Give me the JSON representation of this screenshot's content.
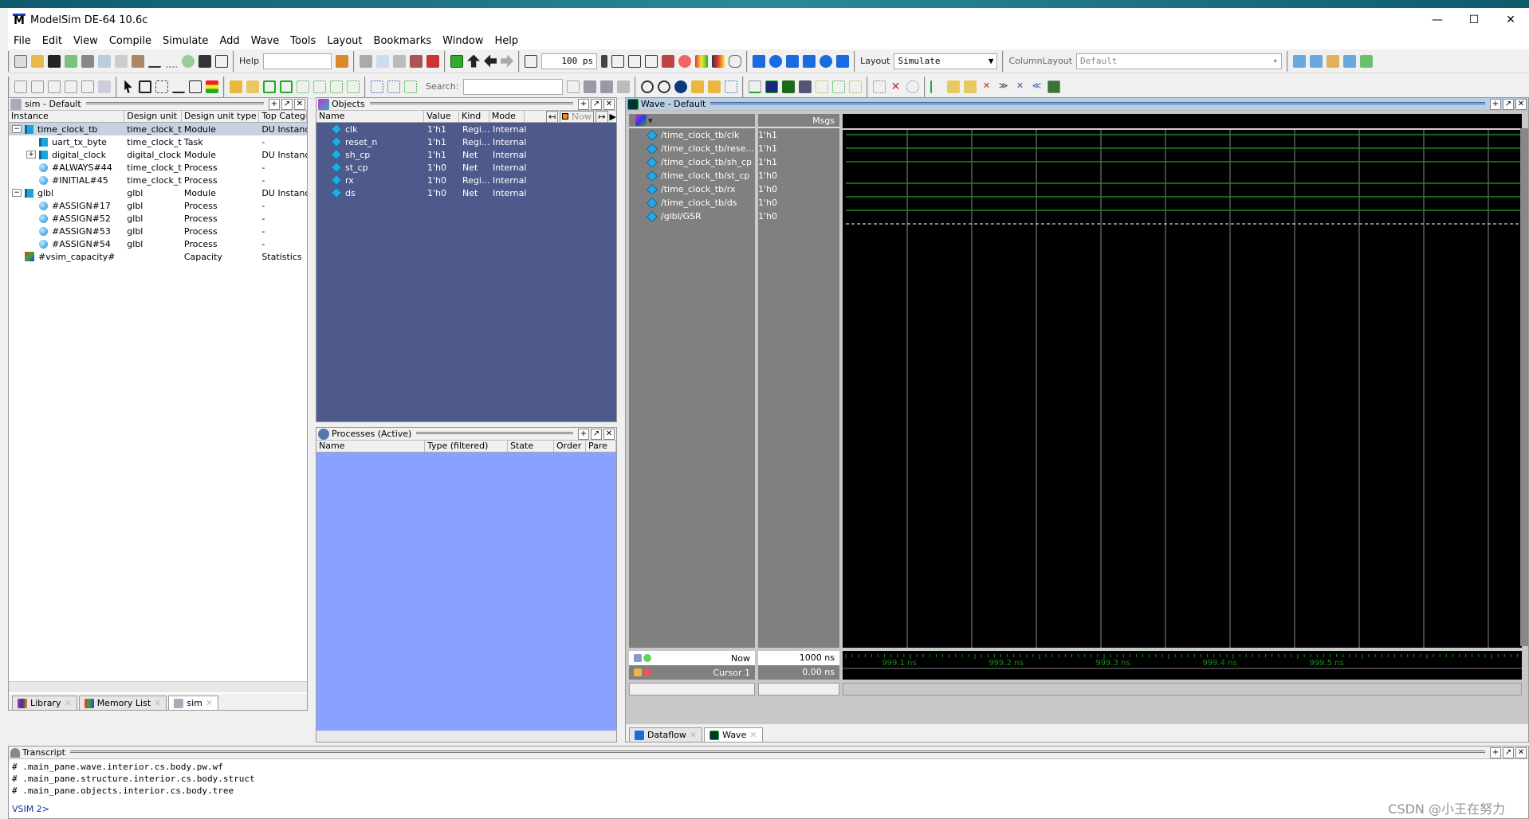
{
  "window": {
    "title": "ModelSim DE-64 10.6c",
    "logo": "M",
    "minimize": "—",
    "maximize": "☐",
    "close": "✕"
  },
  "menu": [
    "File",
    "Edit",
    "View",
    "Compile",
    "Simulate",
    "Add",
    "Wave",
    "Tools",
    "Layout",
    "Bookmarks",
    "Window",
    "Help"
  ],
  "toolbar": {
    "help_label": "Help",
    "help_value": "",
    "time_step": "100 ps",
    "layout_label": "Layout",
    "layout_value": "Simulate",
    "column_layout_label": "ColumnLayout",
    "column_layout_value": "Default",
    "search_label": "Search:",
    "search_value": ""
  },
  "sim_pane": {
    "title": "sim - Default",
    "columns": [
      "Instance",
      "Design unit",
      "Design unit type",
      "Top Categor"
    ],
    "rows": [
      {
        "instance": "time_clock_tb",
        "unit": "time_clock_tb",
        "type": "Module",
        "category": "DU Instance",
        "icon": "module",
        "expander": "−",
        "depth": 0,
        "selected": true
      },
      {
        "instance": "uart_tx_byte",
        "unit": "time_clock_tb",
        "type": "Task",
        "category": "-",
        "icon": "module",
        "expander": "",
        "depth": 1
      },
      {
        "instance": "digital_clock",
        "unit": "digital_clock",
        "type": "Module",
        "category": "DU Instance",
        "icon": "module",
        "expander": "+",
        "depth": 1
      },
      {
        "instance": "#ALWAYS#44",
        "unit": "time_clock_tb",
        "type": "Process",
        "category": "-",
        "icon": "process",
        "expander": "",
        "depth": 1
      },
      {
        "instance": "#INITIAL#45",
        "unit": "time_clock_tb",
        "type": "Process",
        "category": "-",
        "icon": "process",
        "expander": "",
        "depth": 1
      },
      {
        "instance": "glbl",
        "unit": "glbl",
        "type": "Module",
        "category": "DU Instance",
        "icon": "module",
        "expander": "−",
        "depth": 0
      },
      {
        "instance": "#ASSIGN#17",
        "unit": "glbl",
        "type": "Process",
        "category": "-",
        "icon": "process",
        "expander": "",
        "depth": 1
      },
      {
        "instance": "#ASSIGN#52",
        "unit": "glbl",
        "type": "Process",
        "category": "-",
        "icon": "process",
        "expander": "",
        "depth": 1
      },
      {
        "instance": "#ASSIGN#53",
        "unit": "glbl",
        "type": "Process",
        "category": "-",
        "icon": "process",
        "expander": "",
        "depth": 1
      },
      {
        "instance": "#ASSIGN#54",
        "unit": "glbl",
        "type": "Process",
        "category": "-",
        "icon": "process",
        "expander": "",
        "depth": 1
      },
      {
        "instance": "#vsim_capacity#",
        "unit": "",
        "type": "Capacity",
        "category": "Statistics",
        "icon": "capacity",
        "expander": "",
        "depth": 0
      }
    ],
    "tabs": [
      "Library",
      "Memory List",
      "sim"
    ]
  },
  "objects_pane": {
    "title": "Objects",
    "columns": [
      "Name",
      "Value",
      "Kind",
      "Mode"
    ],
    "now_label": "Now",
    "rows": [
      {
        "name": "clk",
        "value": "1'h1",
        "kind": "Regi...",
        "mode": "Internal"
      },
      {
        "name": "reset_n",
        "value": "1'h1",
        "kind": "Regi...",
        "mode": "Internal"
      },
      {
        "name": "sh_cp",
        "value": "1'h1",
        "kind": "Net",
        "mode": "Internal"
      },
      {
        "name": "st_cp",
        "value": "1'h0",
        "kind": "Net",
        "mode": "Internal"
      },
      {
        "name": "rx",
        "value": "1'h0",
        "kind": "Regi...",
        "mode": "Internal"
      },
      {
        "name": "ds",
        "value": "1'h0",
        "kind": "Net",
        "mode": "Internal"
      }
    ]
  },
  "processes_pane": {
    "title": "Processes (Active)",
    "columns": [
      "Name",
      "Type (filtered)",
      "State",
      "Order",
      "Pare"
    ]
  },
  "wave_pane": {
    "title": "Wave - Default",
    "msgs_label": "Msgs",
    "signals": [
      {
        "name": "/time_clock_tb/clk",
        "value": "1'h1",
        "level": 1
      },
      {
        "name": "/time_clock_tb/rese...",
        "value": "1'h1",
        "level": 1
      },
      {
        "name": "/time_clock_tb/sh_cp",
        "value": "1'h1",
        "level": 1
      },
      {
        "name": "/time_clock_tb/st_cp",
        "value": "1'h0",
        "level": 0
      },
      {
        "name": "/time_clock_tb/rx",
        "value": "1'h0",
        "level": 0
      },
      {
        "name": "/time_clock_tb/ds",
        "value": "1'h0",
        "level": 0
      },
      {
        "name": "/glbl/GSR",
        "value": "1'h0",
        "level": "x"
      }
    ],
    "now_label": "Now",
    "now_value": "1000 ns",
    "cursor_label": "Cursor 1",
    "cursor_value": "0.00 ns",
    "timeline": [
      "999.1 ns",
      "999.2 ns",
      "999.3 ns",
      "999.4 ns",
      "999.5 ns"
    ],
    "tabs": [
      "Dataflow",
      "Wave"
    ]
  },
  "transcript": {
    "title": "Transcript",
    "lines": [
      "# .main_pane.wave.interior.cs.body.pw.wf",
      "# .main_pane.structure.interior.cs.body.struct",
      "# .main_pane.objects.interior.cs.body.tree"
    ],
    "prompt": "VSIM 2>"
  },
  "watermark": "CSDN @小王在努力"
}
